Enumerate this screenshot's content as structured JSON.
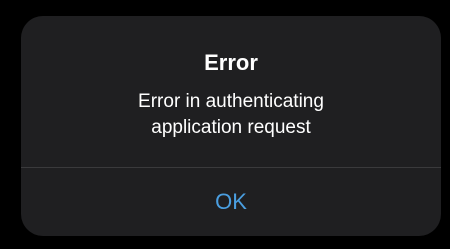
{
  "alert": {
    "title": "Error",
    "message": "Error in authenticating\napplication request",
    "button_label": "OK"
  },
  "colors": {
    "background": "#000000",
    "dialog": "#1f1f21",
    "text": "#ffffff",
    "accent": "#4a9ee0",
    "divider": "#3a3a3c"
  }
}
